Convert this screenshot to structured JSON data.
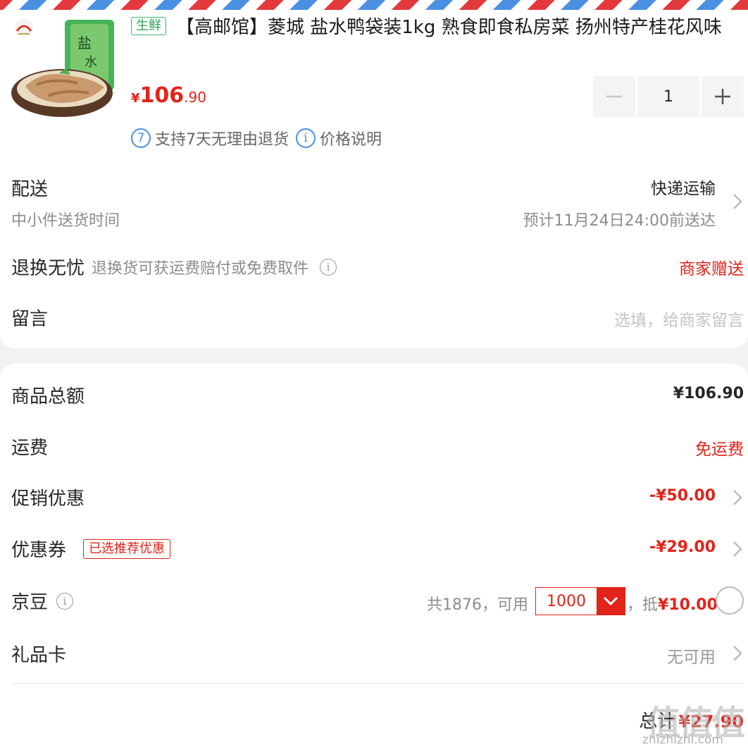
{
  "product": {
    "tag": "生鲜",
    "title": "【高邮馆】菱城 盐水鸭袋装1kg 熟食即食私房菜 扬州特产桂花风味",
    "price_symbol": "¥",
    "price_int": "106",
    "price_dec": ".90",
    "quantity": "1",
    "services": [
      "支持7天无理由退货",
      "价格说明"
    ],
    "service_badge": "7",
    "info_glyph": "i"
  },
  "delivery": {
    "label": "配送",
    "sublabel": "中小件送货时间",
    "method": "快递运输",
    "eta": "预计11月24日24:00前送达"
  },
  "returns": {
    "label": "退换无忧",
    "desc": "退换货可获运费赔付或免费取件",
    "value": "商家赠送"
  },
  "message": {
    "label": "留言",
    "placeholder": "选填，给商家留言"
  },
  "summary": {
    "total_label": "商品总额",
    "total_value": "¥106.90",
    "shipping_label": "运费",
    "shipping_value": "免运费",
    "promo_label": "促销优惠",
    "promo_value": "-¥50.00",
    "coupon_label": "优惠券",
    "coupon_tag": "已选推荐优惠",
    "coupon_value": "-¥29.00",
    "beans_label": "京豆",
    "beans_total": "共1876，可用",
    "beans_selected": "1000",
    "beans_deduct_prefix": "，抵",
    "beans_deduct_value": "¥10.00",
    "giftcard_label": "礼品卡",
    "giftcard_value": "无可用",
    "grand_label": "总计",
    "grand_value": "¥27.90"
  },
  "watermark": {
    "big": "值值值",
    "small": "zhizhizhi.com"
  },
  "colors": {
    "accent": "#e2231a",
    "blue": "#4a90e2",
    "fresh_green": "#3cb371"
  }
}
